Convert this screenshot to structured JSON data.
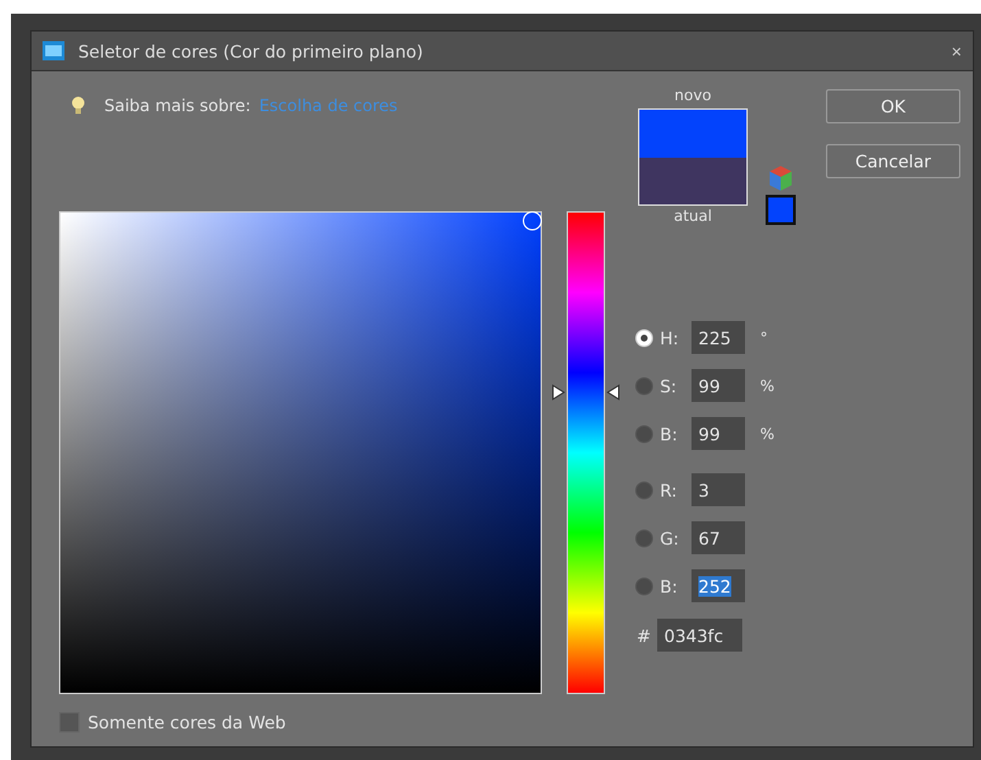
{
  "window": {
    "title": "Seletor de cores (Cor do primeiro plano)",
    "close": "×"
  },
  "help": {
    "text": "Saiba mais sobre:",
    "link": "Escolha de cores"
  },
  "preview": {
    "new_label": "novo",
    "current_label": "atual"
  },
  "buttons": [
    {
      "label": "OK"
    },
    {
      "label": "Cancelar"
    }
  ],
  "hue_slider": {
    "level": 0.625
  },
  "fields": [
    {
      "kind": "radio",
      "label": "H:",
      "value": "225",
      "unit": "°",
      "selected": true,
      "highlighted": false
    },
    {
      "kind": "radio",
      "label": "S:",
      "value": "99",
      "unit": "%",
      "selected": false,
      "highlighted": false
    },
    {
      "kind": "radio",
      "label": "B:",
      "value": "99",
      "unit": "%",
      "selected": false,
      "highlighted": false
    },
    {
      "kind": "radio",
      "label": "R:",
      "value": "3",
      "selected": false,
      "highlighted": false
    },
    {
      "kind": "radio",
      "label": "G:",
      "value": "67",
      "selected": false,
      "highlighted": false
    },
    {
      "kind": "radio",
      "label": "B:",
      "value": "252",
      "selected": false,
      "highlighted": true
    },
    {
      "kind": "hex",
      "label": "#",
      "value": "0343fc"
    }
  ],
  "web_only": {
    "label": "Somente cores da Web",
    "checked": false
  }
}
